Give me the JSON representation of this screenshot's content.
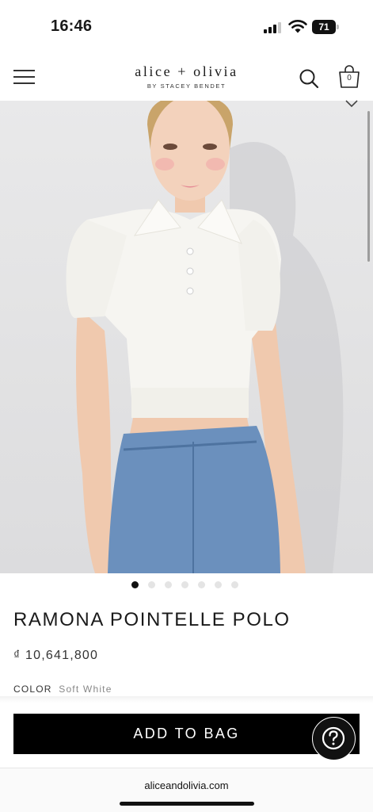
{
  "status_bar": {
    "time": "16:46",
    "signal_icon": "cellular-signal-icon",
    "wifi_icon": "wifi-icon",
    "battery_level": "71"
  },
  "header": {
    "menu_icon": "hamburger-menu-icon",
    "logo_main": "alice + olivia",
    "logo_sub": "BY STACEY BENDET",
    "search_icon": "search-icon",
    "bag_icon": "shopping-bag-icon",
    "bag_count": "0",
    "expand_icon": "chevron-down-icon"
  },
  "gallery": {
    "image_count": 7,
    "active_index": 0
  },
  "product": {
    "title": "RAMONA POINTELLE POLO",
    "price": "₫ 10,641,800",
    "color_label": "COLOR",
    "color_value": "Soft White"
  },
  "actions": {
    "add_to_bag_label": "ADD TO BAG",
    "help_icon": "question-mark-icon"
  },
  "browser": {
    "url": "aliceandolivia.com"
  },
  "colors": {
    "primary": "#000000",
    "background": "#ffffff",
    "muted_text": "#888888"
  }
}
